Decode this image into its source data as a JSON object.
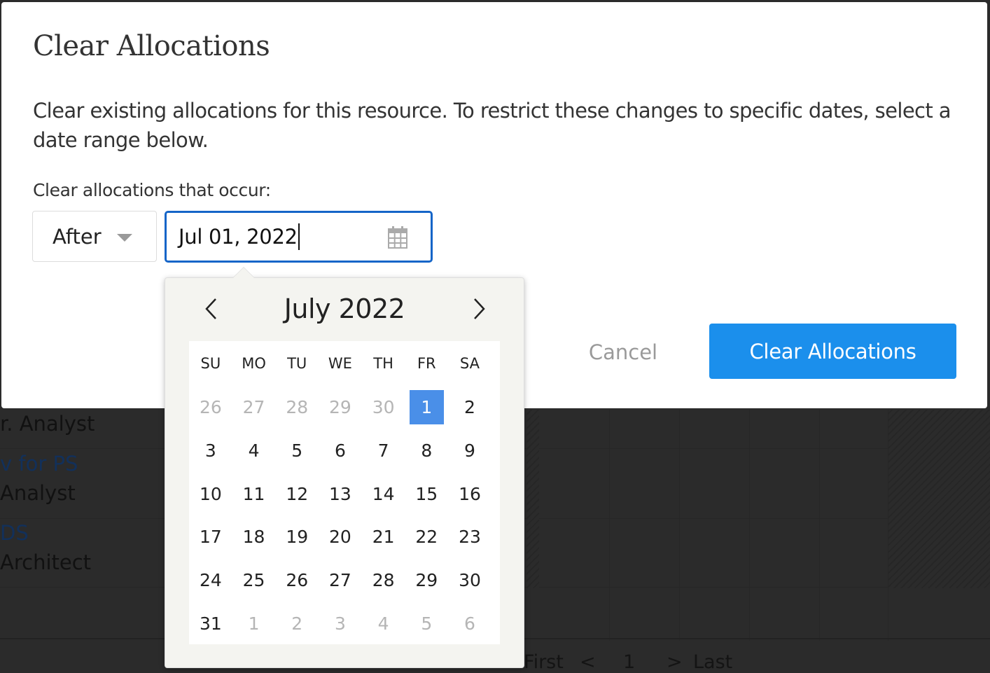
{
  "background": {
    "rows": [
      {
        "text": "r. Analyst",
        "type": "role"
      },
      {
        "text": "v for PS",
        "type": "link"
      },
      {
        "text": " Analyst",
        "type": "role"
      },
      {
        "text": "DS",
        "type": "link"
      },
      {
        "text": " Architect",
        "type": "role"
      }
    ],
    "pager": {
      "first": "First",
      "prev": "<",
      "page": "1",
      "next": ">",
      "last": "Last"
    }
  },
  "modal": {
    "title": "Clear Allocations",
    "description": "Clear existing allocations for this resource. To restrict these changes to specific dates, select a date range below.",
    "field_label": "Clear allocations that occur:",
    "range_select": {
      "value": "After",
      "icon": "chevron-down-icon"
    },
    "date_input": {
      "value": "Jul 01, 2022",
      "icon": "calendar-icon"
    },
    "cancel_label": "Cancel",
    "confirm_label": "Clear Allocations",
    "colors": {
      "primary": "#1b8fec",
      "focus_border": "#1565c8",
      "selected_day": "#4a8fe8"
    }
  },
  "datepicker": {
    "month_label": "July 2022",
    "prev_icon": "chevron-left-icon",
    "next_icon": "chevron-right-icon",
    "weekdays": [
      "SU",
      "MO",
      "TU",
      "WE",
      "TH",
      "FR",
      "SA"
    ],
    "selected": "1",
    "weeks": [
      [
        {
          "d": "26",
          "o": true
        },
        {
          "d": "27",
          "o": true
        },
        {
          "d": "28",
          "o": true
        },
        {
          "d": "29",
          "o": true
        },
        {
          "d": "30",
          "o": true
        },
        {
          "d": "1",
          "s": true
        },
        {
          "d": "2"
        }
      ],
      [
        {
          "d": "3"
        },
        {
          "d": "4"
        },
        {
          "d": "5"
        },
        {
          "d": "6"
        },
        {
          "d": "7"
        },
        {
          "d": "8"
        },
        {
          "d": "9"
        }
      ],
      [
        {
          "d": "10"
        },
        {
          "d": "11"
        },
        {
          "d": "12"
        },
        {
          "d": "13"
        },
        {
          "d": "14"
        },
        {
          "d": "15"
        },
        {
          "d": "16"
        }
      ],
      [
        {
          "d": "17"
        },
        {
          "d": "18"
        },
        {
          "d": "19"
        },
        {
          "d": "20"
        },
        {
          "d": "21"
        },
        {
          "d": "22"
        },
        {
          "d": "23"
        }
      ],
      [
        {
          "d": "24"
        },
        {
          "d": "25"
        },
        {
          "d": "26"
        },
        {
          "d": "27"
        },
        {
          "d": "28"
        },
        {
          "d": "29"
        },
        {
          "d": "30"
        }
      ],
      [
        {
          "d": "31"
        },
        {
          "d": "1",
          "o": true
        },
        {
          "d": "2",
          "o": true
        },
        {
          "d": "3",
          "o": true
        },
        {
          "d": "4",
          "o": true
        },
        {
          "d": "5",
          "o": true
        },
        {
          "d": "6",
          "o": true
        }
      ]
    ]
  }
}
